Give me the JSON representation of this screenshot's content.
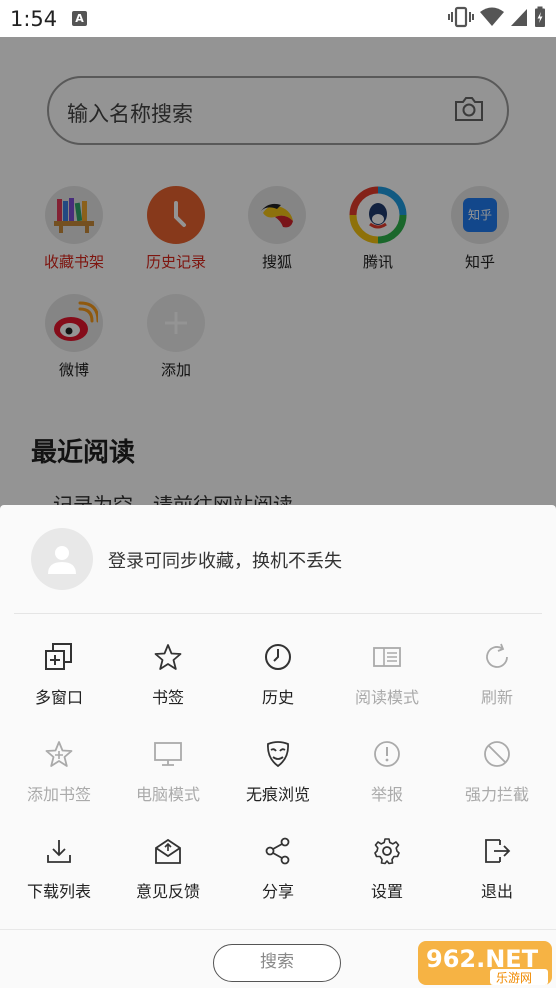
{
  "status_bar": {
    "time": "1:54",
    "notification_letter": "A"
  },
  "search": {
    "placeholder": "输入名称搜索"
  },
  "shortcuts": [
    {
      "label": "收藏书架",
      "icon": "bookshelf-icon",
      "highlight": true
    },
    {
      "label": "历史记录",
      "icon": "clock-icon",
      "highlight": true
    },
    {
      "label": "搜狐",
      "icon": "sohu-icon",
      "highlight": false
    },
    {
      "label": "腾讯",
      "icon": "tencent-icon",
      "highlight": false
    },
    {
      "label": "知乎",
      "icon": "zhihu-icon",
      "highlight": false,
      "logo_text": "知乎"
    },
    {
      "label": "微博",
      "icon": "weibo-icon",
      "highlight": false
    },
    {
      "label": "添加",
      "icon": "plus-icon",
      "highlight": false
    }
  ],
  "recent": {
    "title": "最近阅读",
    "empty_text": "记录为空，请前往网站阅读"
  },
  "sheet": {
    "login_text": "登录可同步收藏，换机不丢失",
    "menu": [
      {
        "label": "多窗口",
        "icon": "multi-window-icon",
        "enabled": true
      },
      {
        "label": "书签",
        "icon": "star-icon",
        "enabled": true
      },
      {
        "label": "历史",
        "icon": "history-clock-icon",
        "enabled": true
      },
      {
        "label": "阅读模式",
        "icon": "reading-mode-icon",
        "enabled": false
      },
      {
        "label": "刷新",
        "icon": "refresh-icon",
        "enabled": false
      },
      {
        "label": "添加书签",
        "icon": "add-bookmark-star-icon",
        "enabled": false
      },
      {
        "label": "电脑模式",
        "icon": "desktop-icon",
        "enabled": false
      },
      {
        "label": "无痕浏览",
        "icon": "incognito-mask-icon",
        "enabled": true
      },
      {
        "label": "举报",
        "icon": "report-icon",
        "enabled": false
      },
      {
        "label": "强力拦截",
        "icon": "block-icon",
        "enabled": false
      },
      {
        "label": "下载列表",
        "icon": "download-icon",
        "enabled": true
      },
      {
        "label": "意见反馈",
        "icon": "feedback-icon",
        "enabled": true
      },
      {
        "label": "分享",
        "icon": "share-icon",
        "enabled": true
      },
      {
        "label": "设置",
        "icon": "gear-icon",
        "enabled": true
      },
      {
        "label": "退出",
        "icon": "exit-icon",
        "enabled": true
      }
    ],
    "bottom_search_label": "搜索"
  },
  "watermark": {
    "text_main": "962.NET",
    "text_sub": "乐游网"
  },
  "colors": {
    "accent_red": "#d9261c",
    "overlay": "rgba(0,0,0,0.42)",
    "clock_orange": "#e8632f"
  }
}
